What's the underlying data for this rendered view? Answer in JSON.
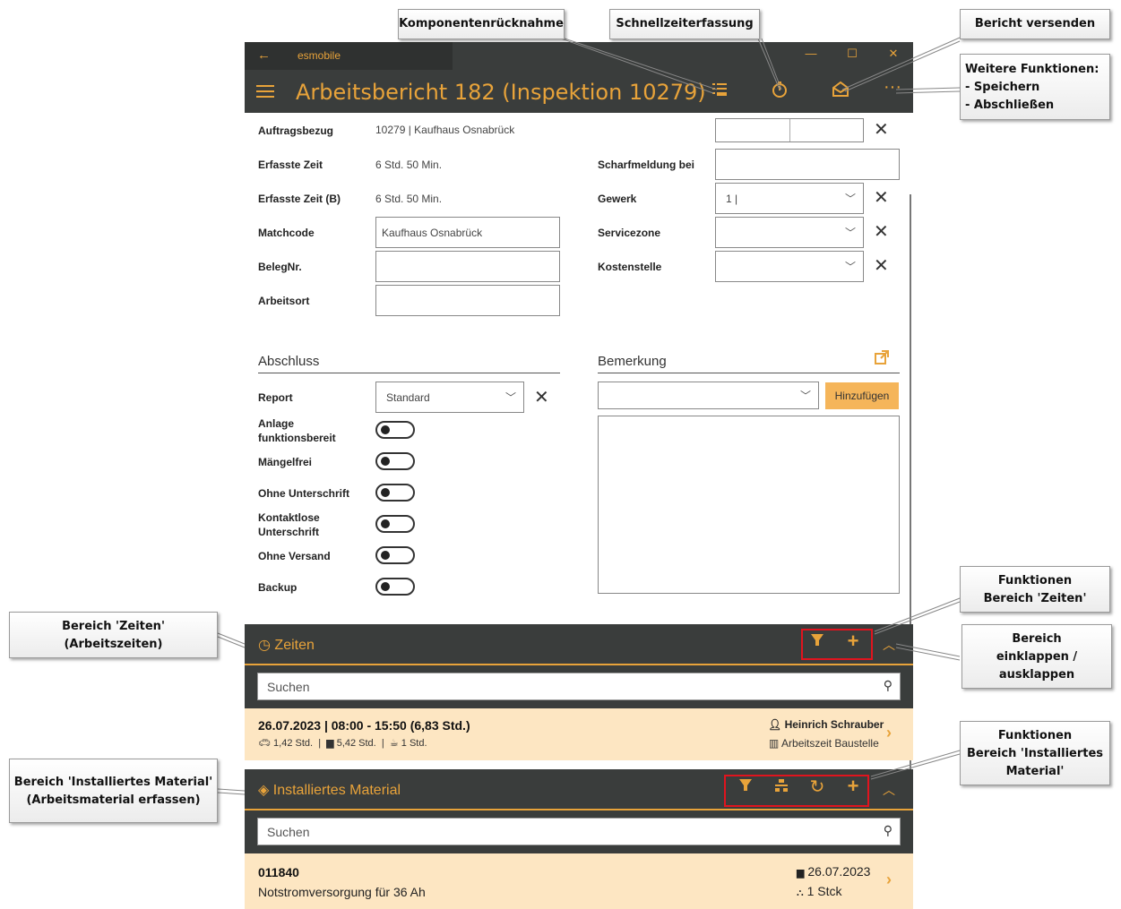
{
  "window": {
    "back_glyph": "←",
    "app_name": "esmobile",
    "minimize": "—",
    "maximize": "☐",
    "close": "✕"
  },
  "header": {
    "title": "Arbeitsbericht 182 (Inspektion 10279)",
    "icons": [
      "component-return-icon",
      "stopwatch-icon",
      "send-mail-icon",
      "more-icon"
    ],
    "more_glyph": "···"
  },
  "form_left": {
    "auftragsbezug_label": "Auftragsbezug",
    "auftragsbezug_value": "10279  |  Kaufhaus Osnabrück",
    "erfasste_zeit_label": "Erfasste Zeit",
    "erfasste_zeit_value": "6 Std. 50 Min.",
    "erfasste_zeit_b_label": "Erfasste Zeit (B)",
    "erfasste_zeit_b_value": "6 Std. 50 Min.",
    "matchcode_label": "Matchcode",
    "matchcode_value": "Kaufhaus Osnabrück",
    "belegnr_label": "BelegNr.",
    "belegnr_value": "",
    "arbeitsort_label": "Arbeitsort",
    "arbeitsort_value": ""
  },
  "form_right": {
    "scharfmeldung_label": "Scharfmeldung bei",
    "gewerk_label": "Gewerk",
    "gewerk_value": "1  |",
    "servicezone_label": "Servicezone",
    "kostenstelle_label": "Kostenstelle"
  },
  "abschluss": {
    "heading": "Abschluss",
    "report_label": "Report",
    "report_value": "Standard",
    "toggles": [
      {
        "label": "Anlage funktionsbereit",
        "on": false
      },
      {
        "label": "Mängelfrei",
        "on": false
      },
      {
        "label": "Ohne Unterschrift",
        "on": false
      },
      {
        "label": "Kontaktlose Unterschrift",
        "on": false
      },
      {
        "label": "Ohne Versand",
        "on": false
      },
      {
        "label": "Backup",
        "on": false
      }
    ]
  },
  "bemerkung": {
    "heading": "Bemerkung",
    "add_button": "Hinzufügen",
    "accent": "#f5b55a"
  },
  "zeiten": {
    "title": "Zeiten",
    "search_placeholder": "Suchen",
    "entry": {
      "date_time": "26.07.2023  |  08:00 - 15:50 (6,83 Std.)",
      "travel": "1,42 Std.",
      "work": "5,42 Std.",
      "break": "1 Std.",
      "person": "Heinrich Schrauber",
      "type": "Arbeitszeit Baustelle"
    }
  },
  "material": {
    "title": "Installiertes Material",
    "search_placeholder": "Suchen",
    "entry": {
      "number": "011840",
      "description": "Notstromversorgung für 36 Ah",
      "date": "26.07.2023",
      "quantity": "1  Stck"
    }
  },
  "callouts": {
    "komponenten": "Komponentenrücknahme",
    "schnellzeit": "Schnellzeiterfassung",
    "bericht": "Bericht versenden",
    "weitere_1": "Weitere Funktionen:",
    "weitere_2": "- Speichern",
    "weitere_3": "- Abschließen",
    "funk_zeiten_1": "Funktionen",
    "funk_zeiten_2": "Bereich 'Zeiten'",
    "einklappen_1": "Bereich",
    "einklappen_2": "einklappen /",
    "einklappen_3": "ausklappen",
    "funk_mat_1": "Funktionen",
    "funk_mat_2": "Bereich 'Installiertes",
    "funk_mat_3": "Material'",
    "bereich_zeiten_1": "Bereich 'Zeiten'",
    "bereich_zeiten_2": "(Arbeitszeiten)",
    "bereich_mat_1": "Bereich 'Installiertes Material'",
    "bereich_mat_2": "(Arbeitsmaterial erfassen)"
  },
  "colors": {
    "accent": "#e8a33a",
    "dark": "#3a3d3c",
    "row_bg": "#fde6c2",
    "highlight": "#e0141e"
  }
}
